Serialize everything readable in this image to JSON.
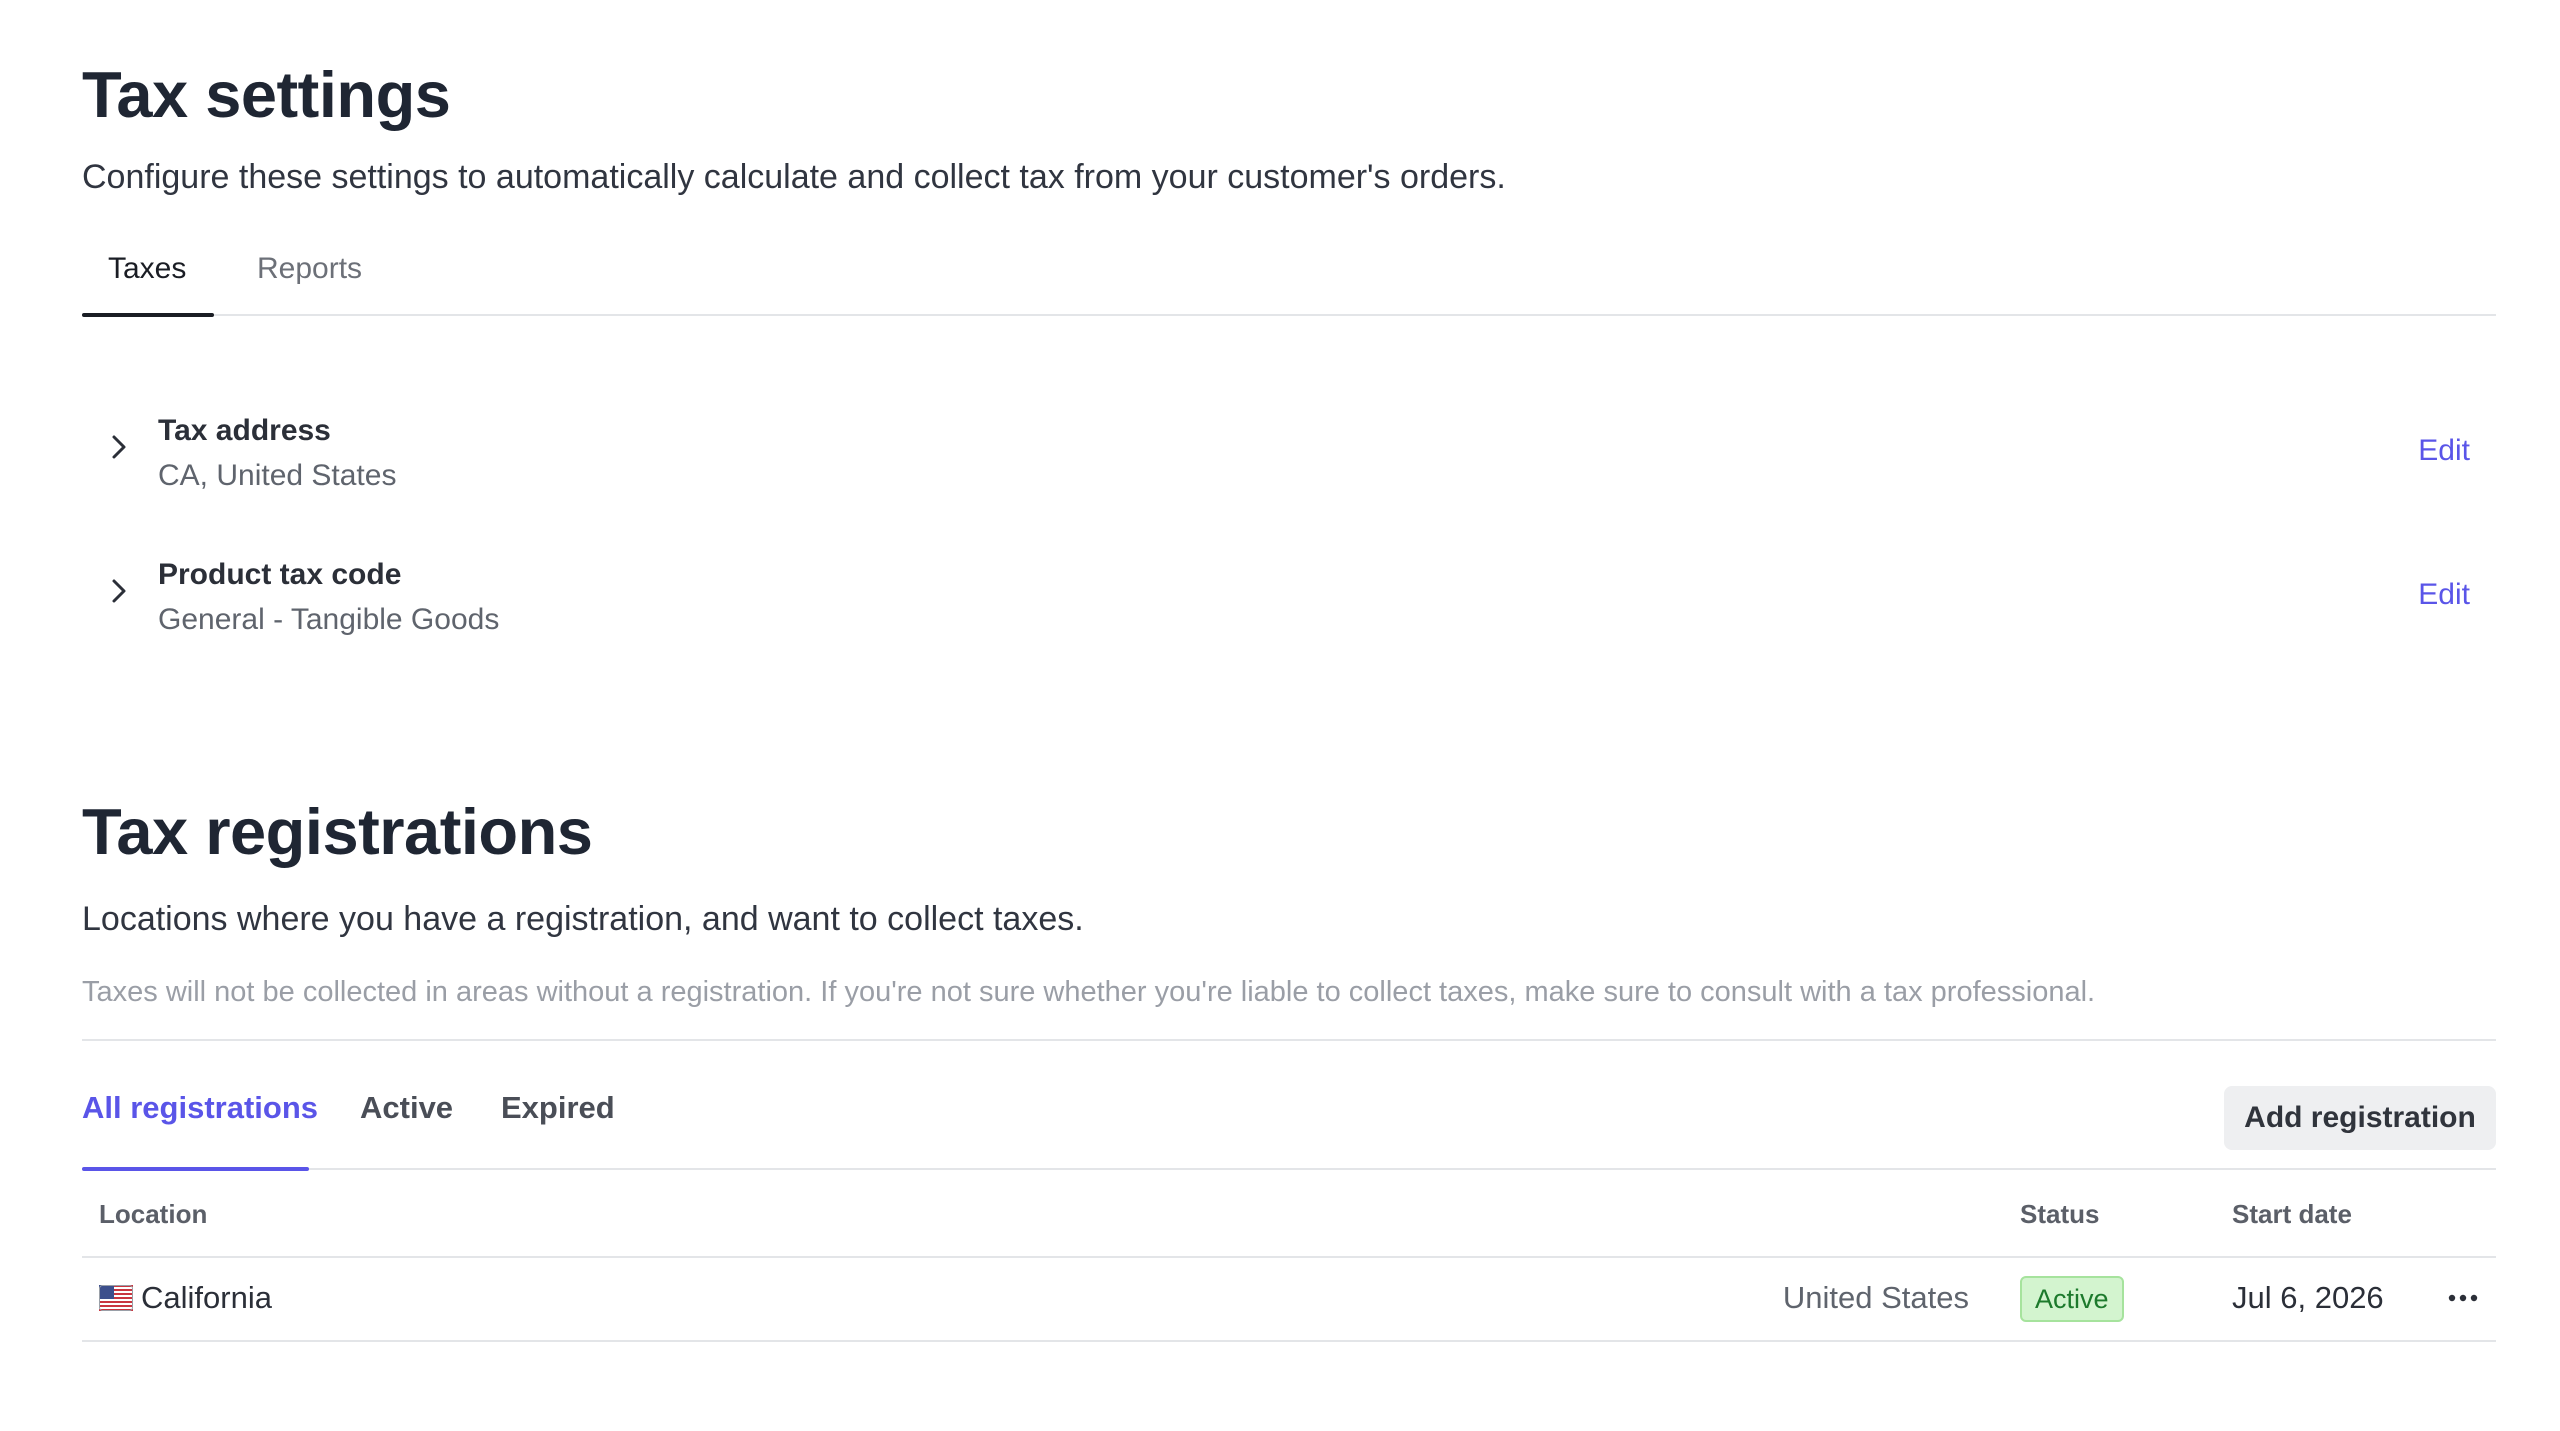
{
  "settings": {
    "title": "Tax settings",
    "subtitle": "Configure these settings to automatically calculate and collect tax from your customer's orders.",
    "tabs": [
      {
        "label": "Taxes",
        "active": true
      },
      {
        "label": "Reports",
        "active": false
      }
    ],
    "rows": [
      {
        "title": "Tax address",
        "value": "CA, United States",
        "action": "Edit",
        "icon": "chevron-right-icon"
      },
      {
        "title": "Product tax code",
        "value": "General - Tangible Goods",
        "action": "Edit",
        "icon": "chevron-right-icon"
      }
    ]
  },
  "registrations": {
    "title": "Tax registrations",
    "subtitle": "Locations where you have a registration, and want to collect taxes.",
    "note": "Taxes will not be collected in areas without a registration. If you're not sure whether you're liable to collect taxes, make sure to consult with a tax professional.",
    "tabs": [
      {
        "label": "All registrations",
        "active": true
      },
      {
        "label": "Active",
        "active": false
      },
      {
        "label": "Expired",
        "active": false
      }
    ],
    "add_button": "Add registration",
    "columns": {
      "location": "Location",
      "status": "Status",
      "start_date": "Start date"
    },
    "rows": [
      {
        "flag": "us-flag-icon",
        "location": "California",
        "country": "United States",
        "status": "Active",
        "start_date": "Jul 6, 2026",
        "menu_icon": "more-horizontal-icon"
      }
    ]
  },
  "colors": {
    "accent": "#5a55e8",
    "heading": "#1f2633",
    "badge_bg": "#d3f4cf",
    "badge_text": "#1c7a2c"
  }
}
